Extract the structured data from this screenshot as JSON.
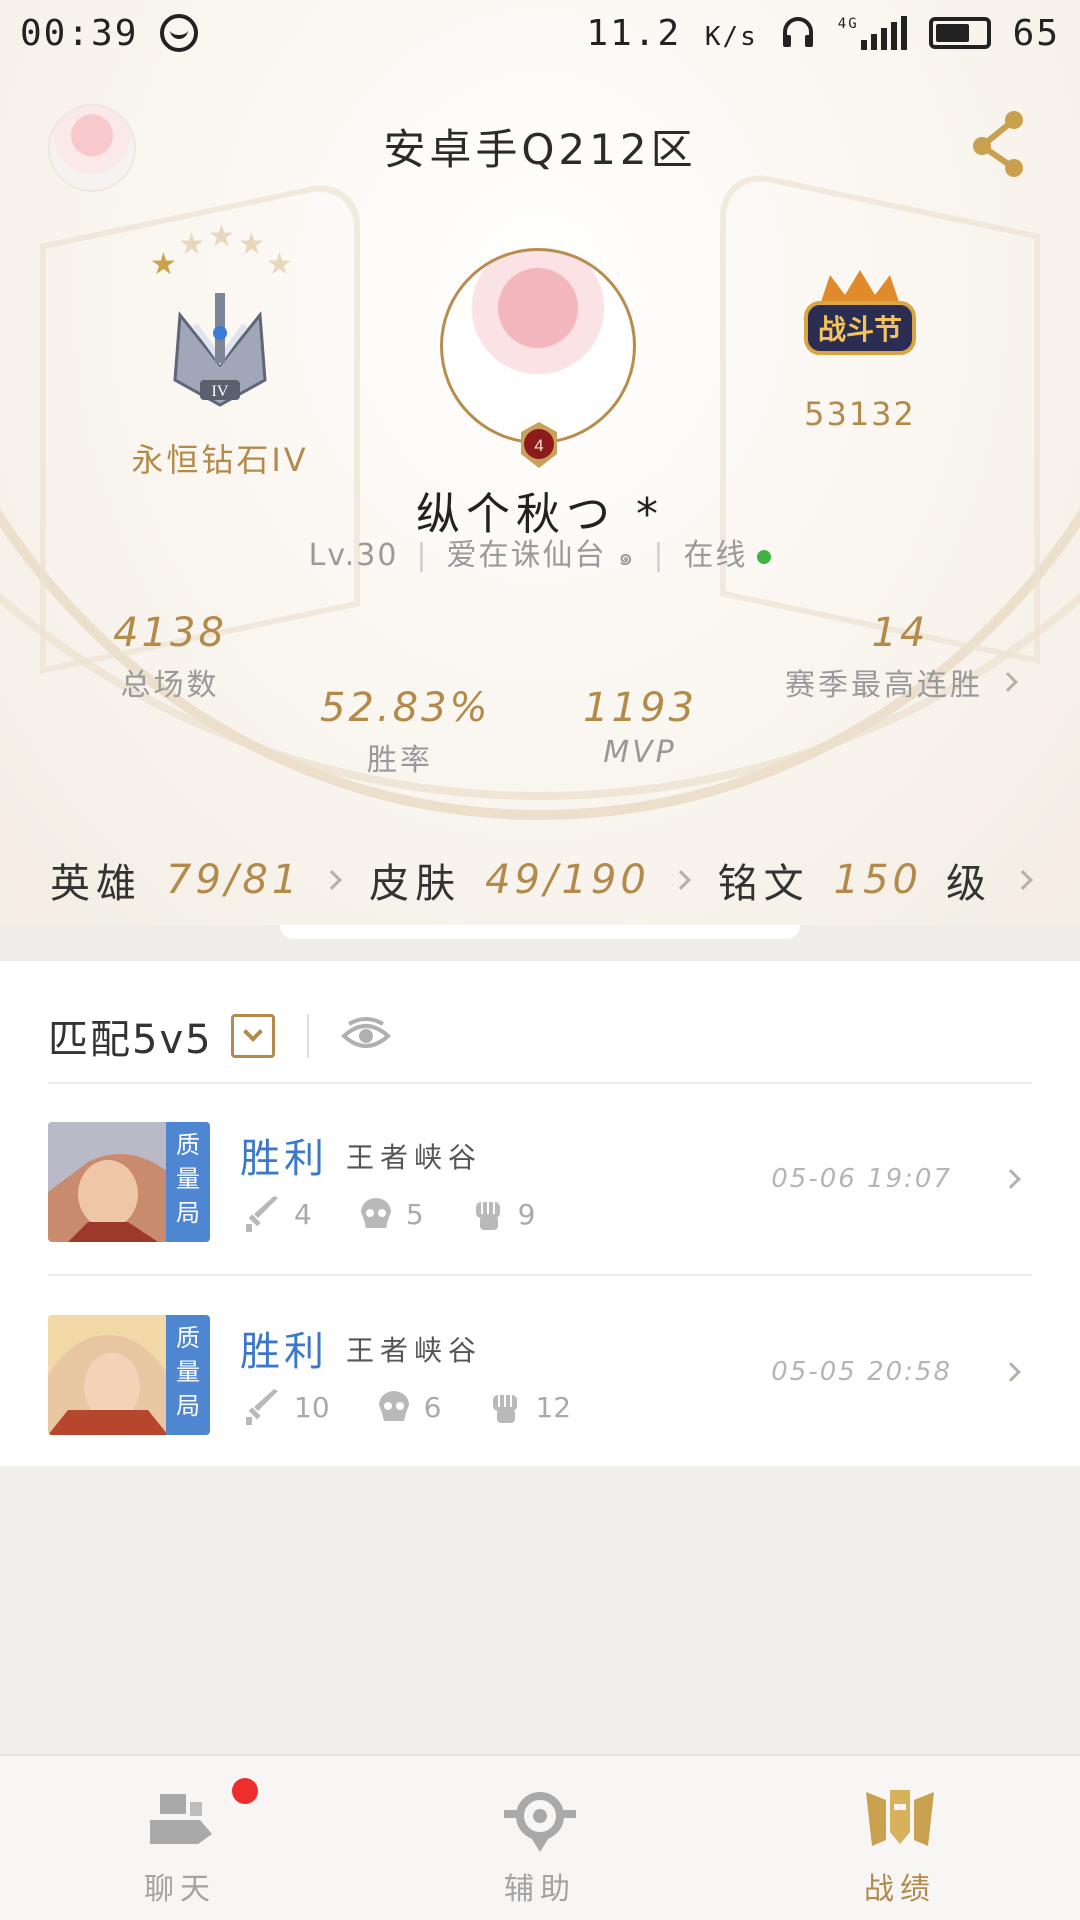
{
  "status_bar": {
    "time": "00:39",
    "net_speed": "11.2",
    "net_unit": "K/s",
    "network": "4G",
    "battery": "65"
  },
  "header": {
    "server": "安卓手Q212区"
  },
  "rank": {
    "name": "永恒钻石IV",
    "stars_total": 5,
    "stars_lit": 1,
    "emblem_text": "IV"
  },
  "honor": {
    "value": "53132",
    "emblem_label": "战斗节"
  },
  "player": {
    "name": "纵个秋つ *",
    "level": "Lv.30",
    "title": "爱在诛仙台",
    "status": "在线",
    "badge_level": "4"
  },
  "stats": {
    "total": {
      "value": "4138",
      "label": "总场数"
    },
    "winrate": {
      "value": "52.83%",
      "label": "胜率"
    },
    "mvp": {
      "value": "1193",
      "label": "MVP"
    },
    "streak": {
      "value": "14",
      "label": "赛季最高连胜"
    }
  },
  "collection": {
    "heroes": {
      "label": "英雄",
      "value": "79/81"
    },
    "skins": {
      "label": "皮肤",
      "value": "49/190"
    },
    "runes": {
      "label": "铭文",
      "value": "150",
      "unit": "级"
    }
  },
  "filter": {
    "mode": "匹配5v5"
  },
  "matches": [
    {
      "badge": "质\n量\n局",
      "result": "胜利",
      "map": "王者峡谷",
      "kills": "4",
      "deaths": "5",
      "assists": "9",
      "time": "05-06 19:07"
    },
    {
      "badge": "质\n量\n局",
      "result": "胜利",
      "map": "王者峡谷",
      "kills": "10",
      "deaths": "6",
      "assists": "12",
      "time": "05-05 20:58"
    }
  ],
  "tabbar": [
    {
      "label": "聊天",
      "icon": "chat-icon",
      "active": false
    },
    {
      "label": "辅助",
      "icon": "assist-icon",
      "active": false
    },
    {
      "label": "战绩",
      "icon": "record-icon",
      "active": true
    }
  ],
  "colors": {
    "gold": "#b38a4a",
    "win_blue": "#3b79c8",
    "badge_blue": "#4f86d2",
    "online_green": "#41b341",
    "notify_red": "#ee2d2d"
  }
}
